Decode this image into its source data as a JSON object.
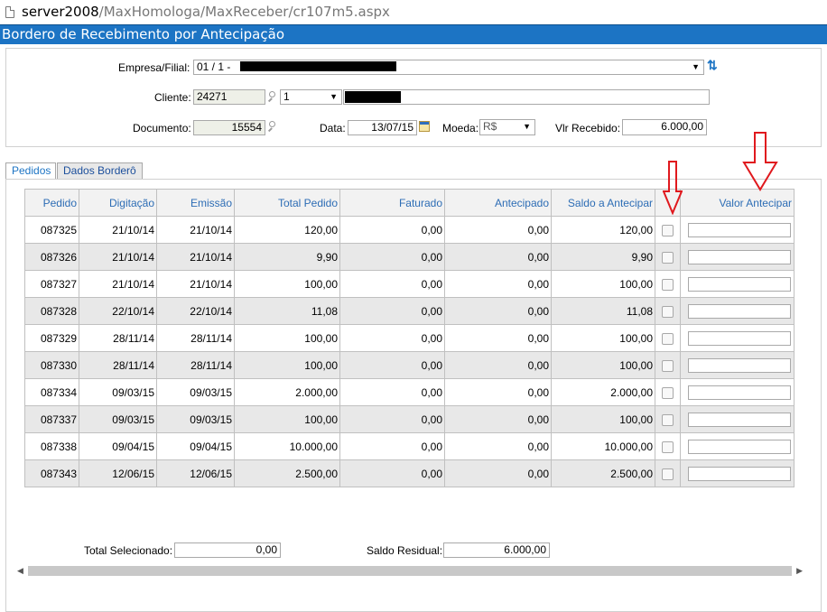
{
  "address_bar": {
    "host": "server2008",
    "path": "/MaxHomologa/MaxReceber/cr107m5.aspx"
  },
  "page_title": "Bordero de Recebimento por Antecipação",
  "filters": {
    "empresa_label": "Empresa/Filial:",
    "empresa_value": "01 / 1 -",
    "cliente_label": "Cliente:",
    "cliente_code": "24271",
    "cliente_select": "1",
    "documento_label": "Documento:",
    "documento_value": "15554",
    "data_label": "Data:",
    "data_value": "13/07/15",
    "moeda_label": "Moeda:",
    "moeda_value": "R$",
    "vlr_label": "Vlr Recebido:",
    "vlr_value": "6.000,00"
  },
  "tabs": [
    {
      "label": "Pedidos"
    },
    {
      "label": "Dados Borderô"
    }
  ],
  "grid": {
    "headers": [
      "Pedido",
      "Digitação",
      "Emissão",
      "Total Pedido",
      "Faturado",
      "Antecipado",
      "Saldo a Antecipar",
      "",
      "Valor Antecipar"
    ],
    "rows": [
      [
        "087325",
        "21/10/14",
        "21/10/14",
        "120,00",
        "0,00",
        "0,00",
        "120,00"
      ],
      [
        "087326",
        "21/10/14",
        "21/10/14",
        "9,90",
        "0,00",
        "0,00",
        "9,90"
      ],
      [
        "087327",
        "21/10/14",
        "21/10/14",
        "100,00",
        "0,00",
        "0,00",
        "100,00"
      ],
      [
        "087328",
        "22/10/14",
        "22/10/14",
        "11,08",
        "0,00",
        "0,00",
        "11,08"
      ],
      [
        "087329",
        "28/11/14",
        "28/11/14",
        "100,00",
        "0,00",
        "0,00",
        "100,00"
      ],
      [
        "087330",
        "28/11/14",
        "28/11/14",
        "100,00",
        "0,00",
        "0,00",
        "100,00"
      ],
      [
        "087334",
        "09/03/15",
        "09/03/15",
        "2.000,00",
        "0,00",
        "0,00",
        "2.000,00"
      ],
      [
        "087337",
        "09/03/15",
        "09/03/15",
        "100,00",
        "0,00",
        "0,00",
        "100,00"
      ],
      [
        "087338",
        "09/04/15",
        "09/04/15",
        "10.000,00",
        "0,00",
        "0,00",
        "10.000,00"
      ],
      [
        "087343",
        "12/06/15",
        "12/06/15",
        "2.500,00",
        "0,00",
        "0,00",
        "2.500,00"
      ]
    ]
  },
  "totals": {
    "total_label": "Total Selecionado:",
    "total_value": "0,00",
    "saldo_label": "Saldo Residual:",
    "saldo_value": "6.000,00"
  },
  "colors": {
    "title_bar": "#1c74c4",
    "annotation_arrow": "#e0191e",
    "header_text": "#2d6db5"
  }
}
